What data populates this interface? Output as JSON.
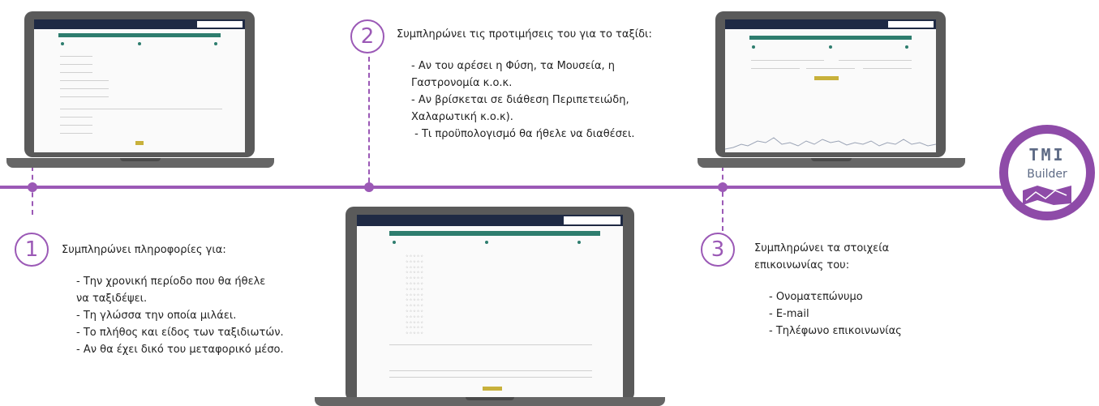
{
  "steps": [
    {
      "number": "1",
      "heading": "Συμπληρώνει πληροφορίες για:",
      "items": [
        "- Την χρονική περίοδο που θα ήθελε",
        "να ταξιδέψει.",
        "- Τη γλώσσα την οποία μιλάει.",
        "- Το πλήθος και είδος των ταξιδιωτών.",
        "- Αν θα έχει δικό του μεταφορικό μέσο."
      ]
    },
    {
      "number": "2",
      "heading": "Συμπληρώνει τις προτιμήσεις του για το ταξίδι:",
      "items": [
        "- Αν του αρέσει η Φύση, τα Μουσεία, η",
        "Γαστρονομία κ.ο.κ.",
        "- Αν βρίσκεται σε διάθεση Περιπετειώδη,",
        "Χαλαρωτική κ.ο.κ).",
        " - Τι προϋπολογισμό θα ήθελε να διαθέσει."
      ]
    },
    {
      "number": "3",
      "heading": "Συμπληρώνει τα στοιχεία",
      "heading2": "επικοινωνίας του:",
      "items": [
        "- Ονοματεπώνυμο",
        "- E-mail",
        "- Τηλέφωνο επικοινωνίας"
      ]
    }
  ],
  "logo": {
    "line1": "TMI",
    "line2": "Builder"
  },
  "colors": {
    "accent": "#9b59b6",
    "logo_ring": "#8e4ba8",
    "screen_header": "#2e7d6e",
    "button": "#c8b13b",
    "topbar": "#1f2a44"
  }
}
